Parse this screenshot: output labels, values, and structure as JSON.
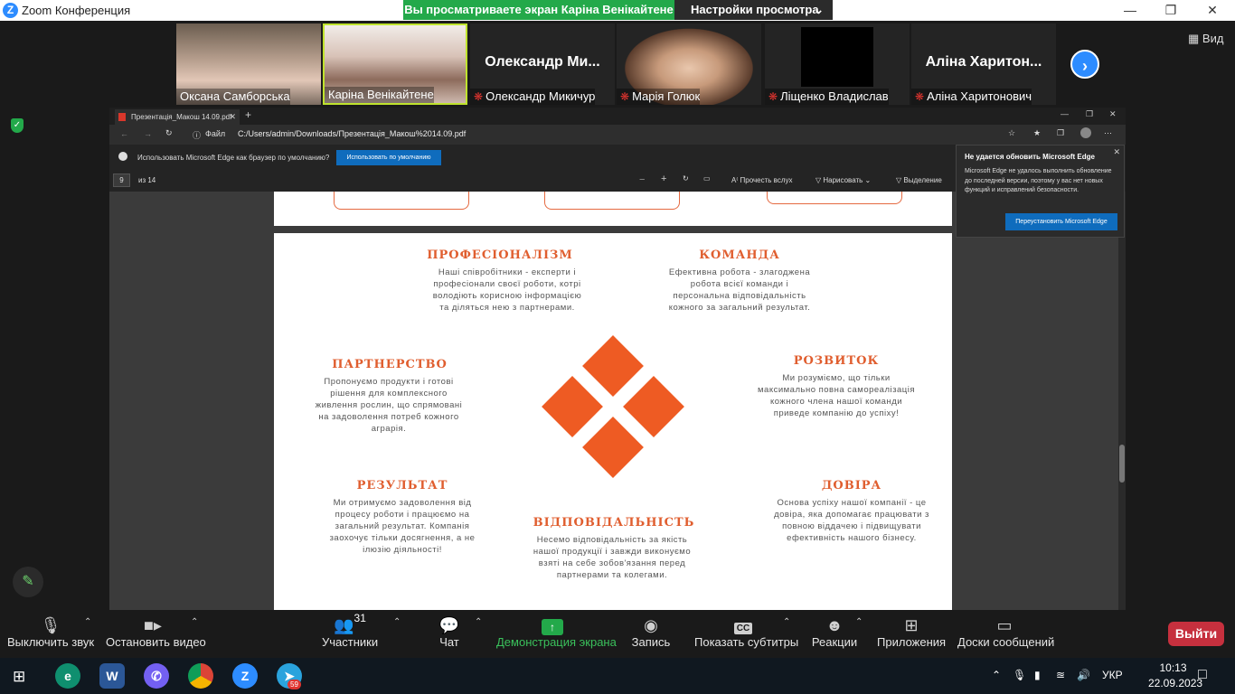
{
  "zoom": {
    "title": "Zoom Конференция",
    "share_banner": "Вы просматриваете экран Каріна Венікайтене",
    "view_options": "Настройки просмотра",
    "view_button": "Вид",
    "participants": [
      {
        "name": "Оксана Самборська",
        "muted": false
      },
      {
        "name": "Каріна Венікайтене",
        "muted": false
      },
      {
        "name": "Олександр Микичур",
        "display": "Олександр Ми...",
        "muted": true
      },
      {
        "name": "Марія Голюк",
        "muted": true
      },
      {
        "name": "Ліщенко Владислав",
        "muted": true
      },
      {
        "name": "Аліна Харитонович",
        "display": "Аліна Харитон...",
        "muted": true
      }
    ],
    "toolbar": {
      "mute": "Выключить звук",
      "video": "Остановить видео",
      "participants": "Участники",
      "participants_count": "31",
      "chat": "Чат",
      "share": "Демонстрация экрана",
      "record": "Запись",
      "captions": "Показать субтитры",
      "reactions": "Реакции",
      "apps": "Приложения",
      "whiteboards": "Доски сообщений",
      "leave": "Выйти"
    }
  },
  "browser": {
    "tab_title": "Презентація_Макош 14.09.pdf",
    "address_prefix": "Файл",
    "address": "C:/Users/admin/Downloads/Презентація_Макош%2014.09.pdf",
    "infobar_text": "Использовать Microsoft Edge как браузер по умолчанию?",
    "infobar_button": "Использовать по умолчанию",
    "page_number": "9",
    "page_total": "из 14",
    "read_aloud": "Прочесть вслух",
    "draw": "Нарисовать",
    "highlight": "Выделение",
    "popup": {
      "title": "Не удается обновить Microsoft Edge",
      "text": "Microsoft Edge не удалось выполнить обновление до последней версии, поэтому у вас нет новых функций и исправлений безопасности.",
      "button": "Переустановить Microsoft Edge"
    }
  },
  "slide": {
    "professionalism": {
      "title": "ПРОФЕСІОНАЛІЗМ",
      "text": "Наші співробітники - експерти і професіонали своєї роботи, котрі володіють корисною інформацією та діляться нею з партнерами."
    },
    "team": {
      "title": "КОМАНДА",
      "text": "Ефективна робота - злагоджена робота всієї команди і персональна відповідальність кожного за загальний результат."
    },
    "partnership": {
      "title": "ПАРТНЕРСТВО",
      "text": "Пропонуємо продукти і готові рішення для комплексного живлення рослин, що спрямовані на задоволення потреб кожного аграрія."
    },
    "development": {
      "title": "РОЗВИТОК",
      "text": "Ми розуміємо, що тільки максимально повна самореалізація кожного члена нашої команди приведе компанію до успіху!"
    },
    "result": {
      "title": "РЕЗУЛЬТАТ",
      "text": "Ми отримуємо задоволення від процесу роботи і працюємо на загальний результат. Компанія заохочує тільки досягнення, а не ілюзію діяльності!"
    },
    "responsibility": {
      "title": "ВІДПОВІДАЛЬНІСТЬ",
      "text": "Несемо відповідальність за якість нашої продукції і завжди виконуємо взяті на себе зобов'язання перед партнерами та колегами."
    },
    "trust": {
      "title": "ДОВІРА",
      "text": "Основа успіху нашої компанії - це довіра, яка допомагає працювати з повною віддачею і підвищувати ефективність нашого бізнесу."
    }
  },
  "taskbar": {
    "telegram_badge": "59",
    "language": "УКР",
    "time": "10:13",
    "date": "22.09.2023"
  },
  "colors": {
    "accent_orange": "#ee5b23",
    "zoom_blue": "#2d8cff",
    "share_green": "#23a94a",
    "leave_red": "#c6303e"
  }
}
